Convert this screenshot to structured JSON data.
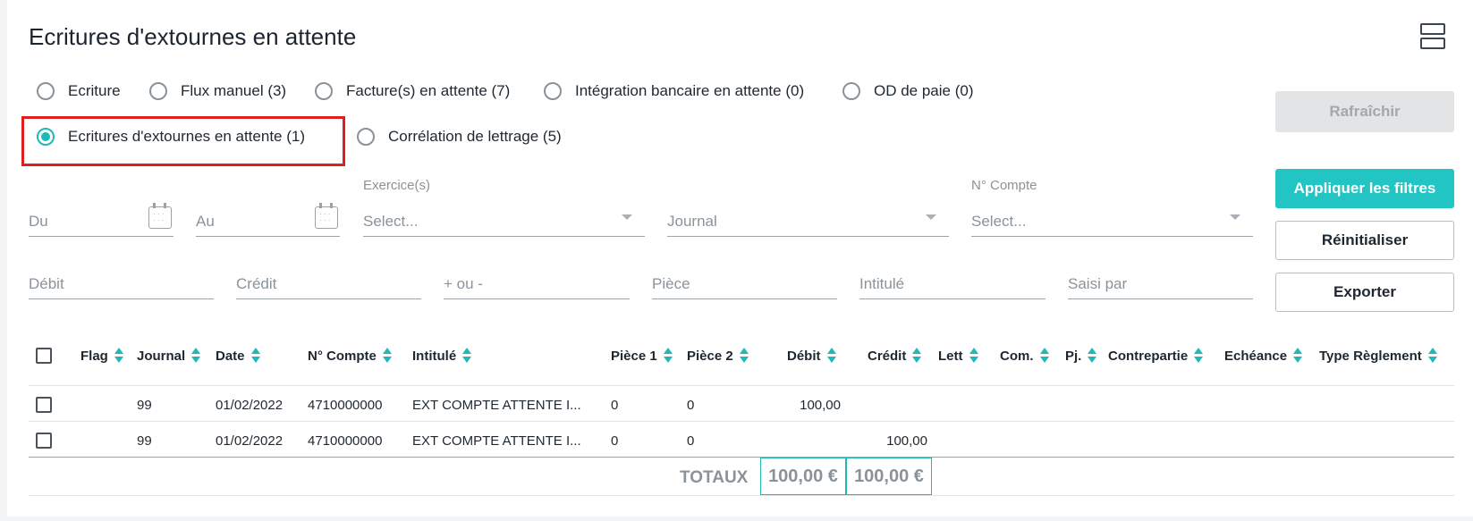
{
  "header": {
    "title": "Ecritures d'extournes en attente",
    "layout_icon": "split-view-icon"
  },
  "radio_options": [
    {
      "label": "Ecriture",
      "checked": false
    },
    {
      "label": "Flux manuel (3)",
      "checked": false
    },
    {
      "label": "Facture(s) en attente (7)",
      "checked": false
    },
    {
      "label": "Intégration bancaire en attente (0)",
      "checked": false
    },
    {
      "label": "OD de paie (0)",
      "checked": false
    },
    {
      "label": "Ecritures d'extournes en attente (1)",
      "checked": true
    },
    {
      "label": "Corrélation de lettrage (5)",
      "checked": false
    }
  ],
  "buttons": {
    "refresh": "Rafraîchir",
    "apply": "Appliquer les filtres",
    "reset": "Réinitialiser",
    "export": "Exporter"
  },
  "filters": {
    "du": "Du",
    "au": "Au",
    "exercice_label": "Exercice(s)",
    "exercice_placeholder": "Select...",
    "journal": "Journal",
    "compte_label": "N° Compte",
    "compte_placeholder": "Select...",
    "debit": "Débit",
    "credit": "Crédit",
    "plus_minus": "+ ou -",
    "piece": "Pièce",
    "intitule": "Intitulé",
    "saisi_par": "Saisi par"
  },
  "table": {
    "columns": [
      "Flag",
      "Journal",
      "Date",
      "N° Compte",
      "Intitulé",
      "Pièce 1",
      "Pièce 2",
      "Débit",
      "Crédit",
      "Lett",
      "Com.",
      "Pj.",
      "Contrepartie",
      "Echéance",
      "Type Règlement"
    ],
    "rows": [
      {
        "journal": "99",
        "date": "01/02/2022",
        "compte": "4710000000",
        "intitule": "EXT COMPTE ATTENTE I...",
        "piece1": "0",
        "piece2": "0",
        "debit": "100,00",
        "credit": ""
      },
      {
        "journal": "99",
        "date": "01/02/2022",
        "compte": "4710000000",
        "intitule": "EXT COMPTE ATTENTE I...",
        "piece1": "0",
        "piece2": "0",
        "debit": "",
        "credit": "100,00"
      }
    ],
    "totals": {
      "label": "TOTAUX",
      "debit": "100,00 €",
      "credit": "100,00 €"
    }
  },
  "colors": {
    "accent": "#22c4c4",
    "highlight": "#e02020"
  }
}
